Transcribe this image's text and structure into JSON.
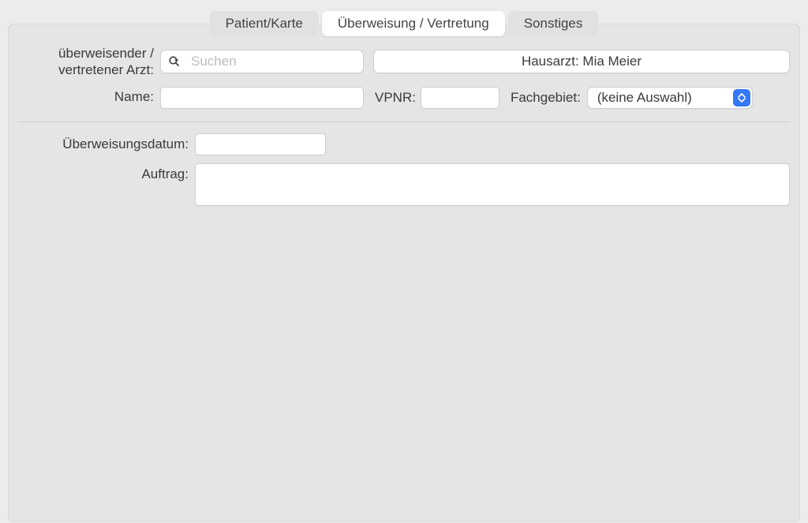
{
  "tabs": {
    "patient": "Patient/Karte",
    "ueberweisung": "Überweisung / Vertretung",
    "sonstiges": "Sonstiges"
  },
  "section1": {
    "arzt_label_line1": "überweisender /",
    "arzt_label_line2": "vertretener Arzt:",
    "search_placeholder": "Suchen",
    "hausarzt_button": "Hausarzt: Mia Meier",
    "name_label": "Name:",
    "name_value": "",
    "vpnr_label": "VPNR:",
    "vpnr_value": "",
    "fachgebiet_label": "Fachgebiet:",
    "fachgebiet_value": "(keine Auswahl)"
  },
  "section2": {
    "datum_label": "Überweisungsdatum:",
    "datum_value": "",
    "auftrag_label": "Auftrag:",
    "auftrag_value": ""
  }
}
